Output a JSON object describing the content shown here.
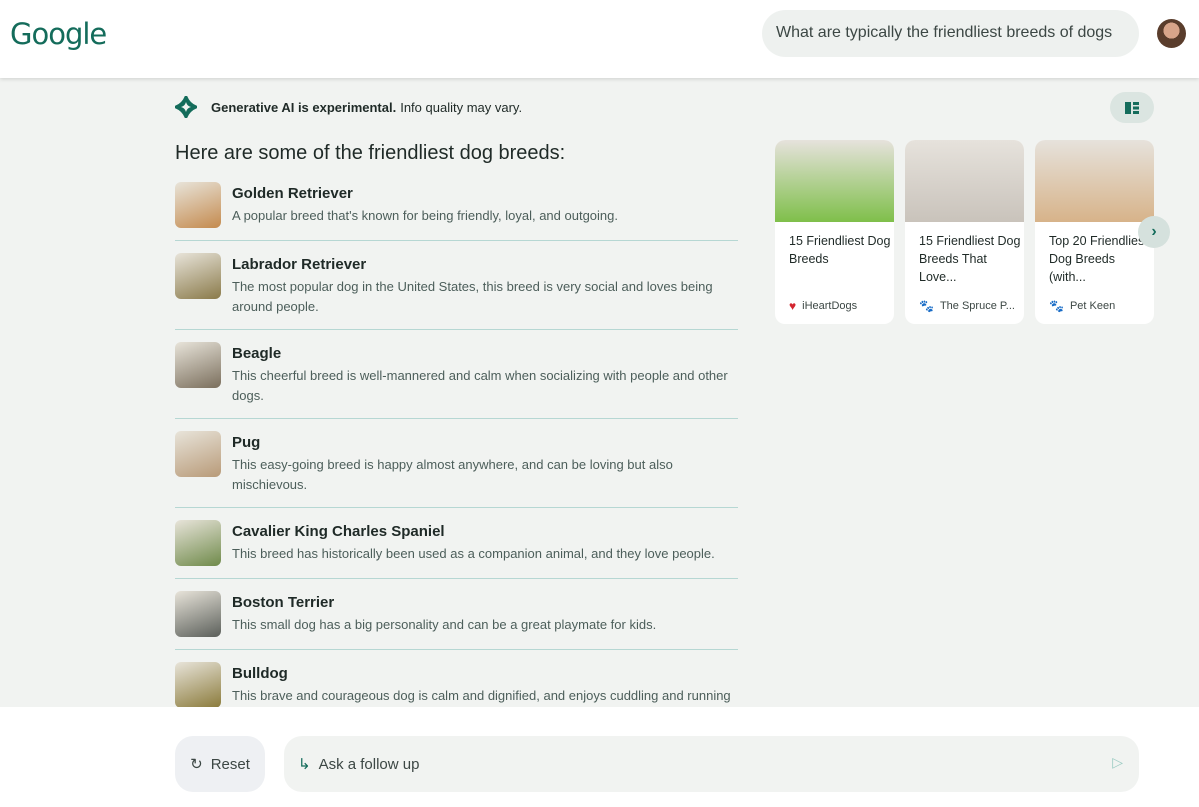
{
  "header": {
    "logo": "Google",
    "query": "What are typically the friendliest breeds of dogs"
  },
  "notice": {
    "bold": "Generative AI is experimental.",
    "rest": "Info quality may vary."
  },
  "answer_title": "Here are some of the friendliest dog breeds:",
  "breeds": [
    {
      "name": "Golden Retriever",
      "desc": "A popular breed that's known for being friendly, loyal, and outgoing.",
      "color": "#c48a4e"
    },
    {
      "name": "Labrador Retriever",
      "desc": "The most popular dog in the United States, this breed is very social and loves being around people.",
      "color": "#8a7a4a"
    },
    {
      "name": "Beagle",
      "desc": "This cheerful breed is well-mannered and calm when socializing with people and other dogs.",
      "color": "#7a6e5c"
    },
    {
      "name": "Pug",
      "desc": "This easy-going breed is happy almost anywhere, and can be loving but also mischievous.",
      "color": "#b89a78"
    },
    {
      "name": "Cavalier King Charles Spaniel",
      "desc": "This breed has historically been used as a companion animal, and they love people.",
      "color": "#6f8a4a"
    },
    {
      "name": "Boston Terrier",
      "desc": "This small dog has a big personality and can be a great playmate for kids.",
      "color": "#5b5f5a"
    },
    {
      "name": "Bulldog",
      "desc": "This brave and courageous dog is calm and dignified, and enjoys cuddling and running",
      "color": "#8a7a3a"
    }
  ],
  "sources": [
    {
      "title": "15 Friendliest Dog Breeds",
      "site": "iHeartDogs",
      "icon": "heart-paw-icon",
      "icon_color": "#d3252f",
      "img": "#7fbf4a"
    },
    {
      "title": "15 Friendliest Dog Breeds That Love...",
      "site": "The Spruce P...",
      "icon": "paw-icon",
      "icon_color": "#b0474f",
      "img": "#c9c3bb"
    },
    {
      "title": "Top 20 Friendliest Dog Breeds (with...",
      "site": "Pet Keen",
      "icon": "paw-icon",
      "icon_color": "#1e9a86",
      "img": "#d7b38a"
    }
  ],
  "footer": {
    "reset": "Reset",
    "ask_placeholder": "Ask a follow up"
  }
}
